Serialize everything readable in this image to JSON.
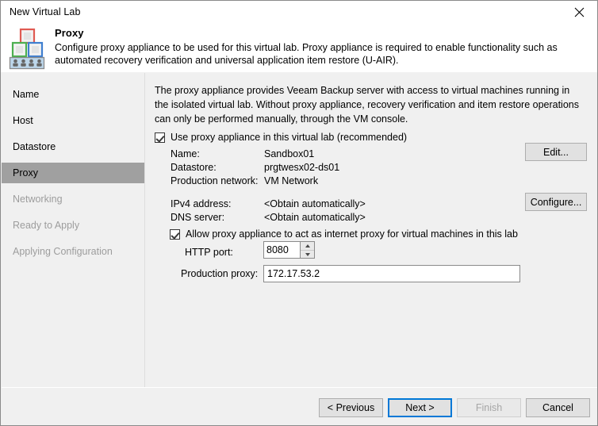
{
  "window": {
    "title": "New Virtual Lab",
    "close_icon": "close-icon"
  },
  "header": {
    "icon": "virtual-lab-icon",
    "title": "Proxy",
    "description": "Configure proxy appliance to be used for this virtual lab. Proxy appliance is required to enable functionality such as automated recovery verification and universal application item restore (U-AIR)."
  },
  "sidebar": {
    "items": [
      {
        "label": "Name",
        "state": "normal"
      },
      {
        "label": "Host",
        "state": "normal"
      },
      {
        "label": "Datastore",
        "state": "normal"
      },
      {
        "label": "Proxy",
        "state": "active"
      },
      {
        "label": "Networking",
        "state": "dim"
      },
      {
        "label": "Ready to Apply",
        "state": "dim"
      },
      {
        "label": "Applying Configuration",
        "state": "dim"
      }
    ]
  },
  "content": {
    "intro": "The proxy appliance provides Veeam Backup server with access to virtual machines running in the isolated virtual lab. Without proxy appliance, recovery verification and item restore operations can only be performed manually, through the VM console.",
    "use_proxy_checkbox": {
      "label": "Use proxy appliance in this virtual lab (recommended)",
      "checked": true
    },
    "appliance_fields": [
      {
        "label": "Name:",
        "value": "Sandbox01"
      },
      {
        "label": "Datastore:",
        "value": "prgtwesx02-ds01"
      },
      {
        "label": "Production network:",
        "value": "VM Network"
      }
    ],
    "network_fields": [
      {
        "label": "IPv4 address:",
        "value": "<Obtain automatically>"
      },
      {
        "label": "DNS server:",
        "value": "<Obtain automatically>"
      }
    ],
    "edit_button": "Edit...",
    "configure_button": "Configure...",
    "internet_proxy_checkbox": {
      "label": "Allow proxy appliance to act as internet proxy for virtual machines in this lab",
      "checked": true
    },
    "http_port": {
      "label": "HTTP port:",
      "value": "8080"
    },
    "production_proxy": {
      "label": "Production proxy:",
      "value": "172.17.53.2",
      "placeholder": ""
    }
  },
  "footer": {
    "previous_button": "< Previous",
    "next_button": "Next >",
    "finish_button": "Finish",
    "cancel_button": "Cancel"
  },
  "colors": {
    "accent": "#0078d7",
    "surface": "#f0f0f0",
    "selection": "#a0a0a0",
    "icon_red": "#e05a52",
    "icon_green": "#4caf50",
    "icon_blue": "#3f7fd0",
    "icon_bar": "#bcd6ea"
  }
}
